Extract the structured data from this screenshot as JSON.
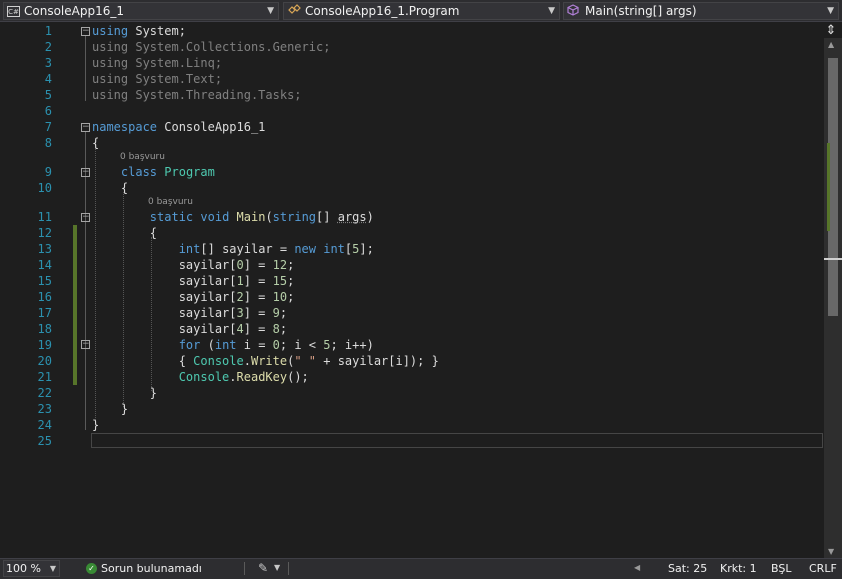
{
  "navbar": {
    "project": "ConsoleApp16_1",
    "class": "ConsoleApp16_1.Program",
    "member": "Main(string[] args)",
    "project_icon_text": "C#"
  },
  "icons": {
    "project": "csharp-project-icon",
    "class": "class-icon",
    "member": "method-icon",
    "split": "split-window-icon",
    "fold": "collapse-icon",
    "issues": "checkmark-circle-icon",
    "cleanup": "code-cleanup-brush-icon"
  },
  "colors": {
    "keyword": "#569cd6",
    "type": "#4ec9b0",
    "string": "#d69d85",
    "method": "#dcdcaa",
    "number": "#b5cea8",
    "line_number": "#2b91af",
    "change_marker": "#57752a",
    "background": "#1e1e1e"
  },
  "line_numbers": [
    "1",
    "2",
    "3",
    "4",
    "5",
    "6",
    "7",
    "8",
    "9",
    "10",
    "11",
    "12",
    "13",
    "14",
    "15",
    "16",
    "17",
    "18",
    "19",
    "20",
    "21",
    "22",
    "23",
    "24",
    "25"
  ],
  "code": {
    "l1": [
      [
        "k",
        "using"
      ],
      [
        "p",
        " System;"
      ]
    ],
    "l2": [
      [
        "d",
        "using System.Collections.Generic;"
      ]
    ],
    "l3": [
      [
        "d",
        "using System.Linq;"
      ]
    ],
    "l4": [
      [
        "d",
        "using System.Text;"
      ]
    ],
    "l5": [
      [
        "d",
        "using System.Threading.Tasks;"
      ]
    ],
    "l7": [
      [
        "k",
        "namespace"
      ],
      [
        "p",
        " ConsoleApp16_1"
      ]
    ],
    "l8": [
      [
        "p",
        "{"
      ]
    ],
    "lens9": "0 başvuru",
    "l9": [
      [
        "p",
        "    "
      ],
      [
        "k",
        "class"
      ],
      [
        "p",
        " "
      ],
      [
        "t",
        "Program"
      ]
    ],
    "l10": [
      [
        "p",
        "    {"
      ]
    ],
    "lens11": "0 başvuru",
    "l11": [
      [
        "p",
        "        "
      ],
      [
        "k",
        "static"
      ],
      [
        "p",
        " "
      ],
      [
        "k",
        "void"
      ],
      [
        "p",
        " "
      ],
      [
        "m",
        "Main"
      ],
      [
        "p",
        "("
      ],
      [
        "k",
        "string"
      ],
      [
        "p",
        "[] "
      ],
      [
        "u",
        "args"
      ],
      [
        "p",
        ")"
      ]
    ],
    "l12": [
      [
        "p",
        "        {"
      ]
    ],
    "l13": [
      [
        "p",
        "            "
      ],
      [
        "k",
        "int"
      ],
      [
        "p",
        "[] sayilar = "
      ],
      [
        "k",
        "new"
      ],
      [
        "p",
        " "
      ],
      [
        "k",
        "int"
      ],
      [
        "p",
        "["
      ],
      [
        "n",
        "5"
      ],
      [
        "p",
        "];"
      ]
    ],
    "l14": [
      [
        "p",
        "            sayilar["
      ],
      [
        "n",
        "0"
      ],
      [
        "p",
        "] = "
      ],
      [
        "n",
        "12"
      ],
      [
        "p",
        ";"
      ]
    ],
    "l15": [
      [
        "p",
        "            sayilar["
      ],
      [
        "n",
        "1"
      ],
      [
        "p",
        "] = "
      ],
      [
        "n",
        "15"
      ],
      [
        "p",
        ";"
      ]
    ],
    "l16": [
      [
        "p",
        "            sayilar["
      ],
      [
        "n",
        "2"
      ],
      [
        "p",
        "] = "
      ],
      [
        "n",
        "10"
      ],
      [
        "p",
        ";"
      ]
    ],
    "l17": [
      [
        "p",
        "            sayilar["
      ],
      [
        "n",
        "3"
      ],
      [
        "p",
        "] = "
      ],
      [
        "n",
        "9"
      ],
      [
        "p",
        ";"
      ]
    ],
    "l18": [
      [
        "p",
        "            sayilar["
      ],
      [
        "n",
        "4"
      ],
      [
        "p",
        "] = "
      ],
      [
        "n",
        "8"
      ],
      [
        "p",
        ";"
      ]
    ],
    "l19": [
      [
        "p",
        "            "
      ],
      [
        "k",
        "for"
      ],
      [
        "p",
        " ("
      ],
      [
        "k",
        "int"
      ],
      [
        "p",
        " i = "
      ],
      [
        "n",
        "0"
      ],
      [
        "p",
        "; i < "
      ],
      [
        "n",
        "5"
      ],
      [
        "p",
        "; i++)"
      ]
    ],
    "l20": [
      [
        "p",
        "            { "
      ],
      [
        "t",
        "Console"
      ],
      [
        "p",
        "."
      ],
      [
        "m",
        "Write"
      ],
      [
        "p",
        "("
      ],
      [
        "s",
        "\" \""
      ],
      [
        "p",
        " + sayilar[i]); }"
      ]
    ],
    "l21": [
      [
        "p",
        "            "
      ],
      [
        "t",
        "Console"
      ],
      [
        "p",
        "."
      ],
      [
        "m",
        "ReadKey"
      ],
      [
        "p",
        "();"
      ]
    ],
    "l22": [
      [
        "p",
        "        }"
      ]
    ],
    "l23": [
      [
        "p",
        "    }"
      ]
    ],
    "l24": [
      [
        "p",
        "}"
      ]
    ]
  },
  "status": {
    "zoom": "100 %",
    "issues": "Sorun bulunamadı",
    "line": "Sat: 25",
    "col": "Krkt: 1",
    "indent": "BŞL",
    "eol": "CRLF"
  }
}
